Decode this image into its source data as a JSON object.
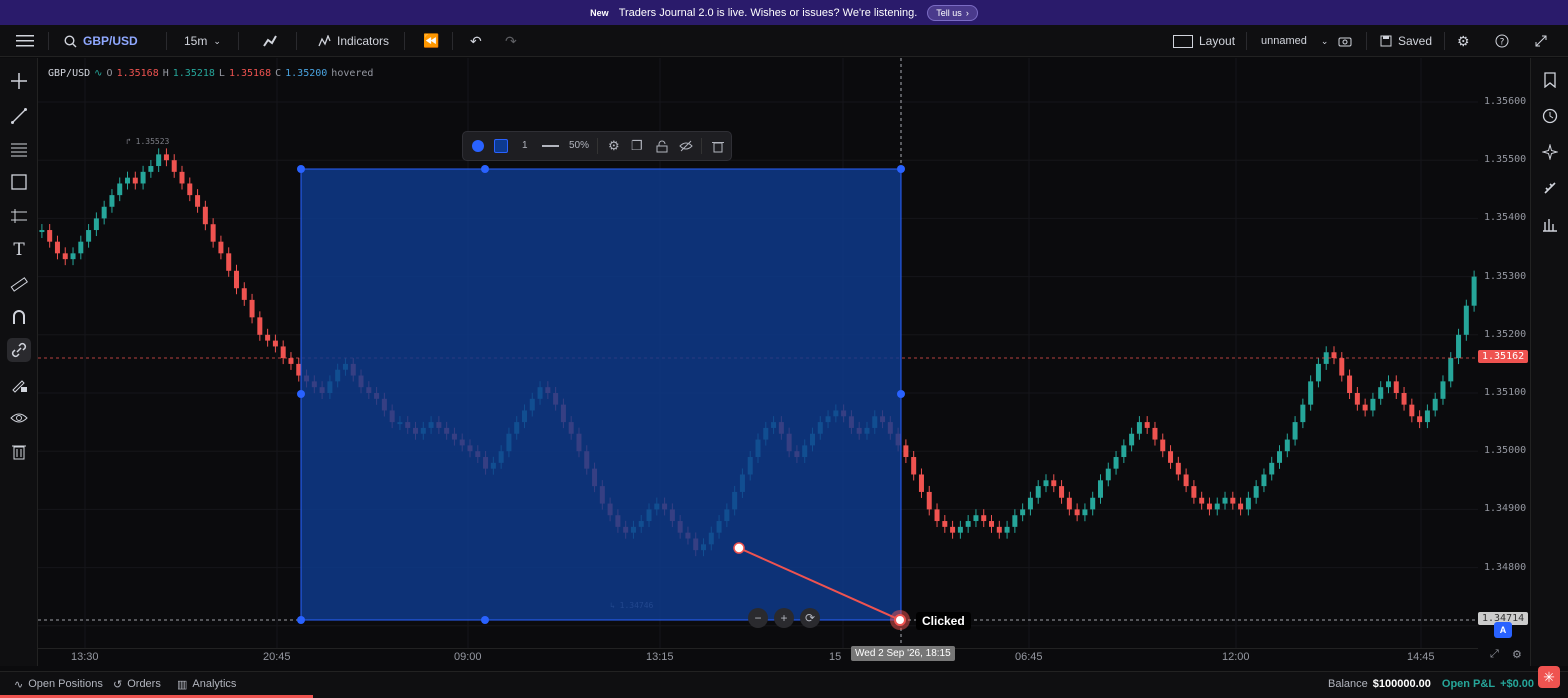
{
  "banner": {
    "new": "New",
    "message": "Traders Journal 2.0 is live. Wishes or issues? We're listening.",
    "cta": "Tell us"
  },
  "topbar": {
    "symbol": "GBP/USD",
    "interval": "15m",
    "indicators": "Indicators",
    "layout": "Layout",
    "layout_name": "unnamed",
    "saved": "Saved"
  },
  "legend": {
    "symbol": "GBP/USD",
    "o_label": "O",
    "o": "1.35168",
    "h_label": "H",
    "h": "1.35218",
    "l_label": "L",
    "l": "1.35168",
    "c_label": "C",
    "c": "1.35200",
    "state": "hovered"
  },
  "float_toolbar": {
    "width": "1",
    "opacity": "50%"
  },
  "price_axis": {
    "labels": [
      "1.35600",
      "1.35500",
      "1.35400",
      "1.35300",
      "1.35200",
      "1.35100",
      "1.35000",
      "1.34900",
      "1.34800"
    ],
    "current_price": "1.35162",
    "cursor_price": "1.34714"
  },
  "time_axis": {
    "labels": [
      "13:30",
      "20:45",
      "09:00",
      "13:15",
      "15",
      "06:45",
      "12:00",
      "14:45"
    ]
  },
  "annotations": {
    "high_label": "1.35523",
    "low_label": "1.34746",
    "clicked": "Clicked",
    "time_tag": "Wed 2 Sep '26, 18:15",
    "axis_badge": "A"
  },
  "bottombar": {
    "positions": "Open Positions",
    "orders": "Orders",
    "analytics": "Analytics",
    "balance_label": "Balance",
    "balance": "$100000.00",
    "pnl_label": "Open P&L",
    "pnl": "+$0.00"
  },
  "colors": {
    "up": "#26a69a",
    "down": "#ef5350",
    "box": "#0d3a8f",
    "accent": "#2962ff"
  }
}
